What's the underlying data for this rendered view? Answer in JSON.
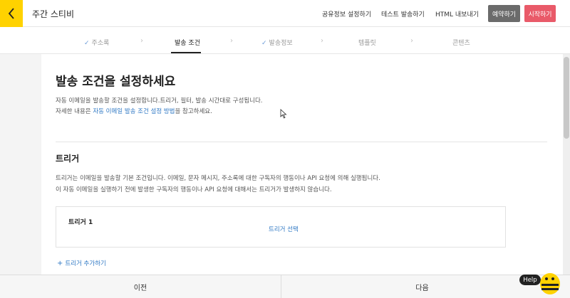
{
  "header": {
    "title": "주간 스티비",
    "links": [
      "공유정보 설정하기",
      "테스트 발송하기",
      "HTML 내보내기"
    ],
    "reserve_label": "예약하기",
    "start_label": "시작하기"
  },
  "steps": [
    {
      "label": "주소록",
      "checked": true
    },
    {
      "label": "발송 조건",
      "active": true
    },
    {
      "label": "발송정보",
      "checked": true
    },
    {
      "label": "템플릿"
    },
    {
      "label": "콘텐츠"
    }
  ],
  "main": {
    "title": "발송 조건을 설정하세요",
    "desc_line1": "자동 이메일을 발송할 조건을 설정합니다.트리거, 필터, 발송 시간대로 구성됩니다.",
    "desc_line2_prefix": "자세한 내용은 ",
    "desc_line2_link": "자동 이메일 발송 조건 설정 방법",
    "desc_line2_suffix": "을 참고하세요.",
    "section_title": "트리거",
    "section_desc1": "트리거는 이메일을 발송할 기본 조건입니다. 이메일, 문자 메시지, 주소록에 대한 구독자의 행동이나 API 요청에 의해 실행됩니다.",
    "section_desc2": "이 자동 이메일을 실행하기 전에 발생한 구독자의 행동이나 API 요청에 대해서는 트리거가 발생하지 않습니다.",
    "trigger_label": "트리거 1",
    "trigger_select": "트리거 선택",
    "add_trigger": "트리거 추가하기"
  },
  "footer": {
    "prev_label": "이전",
    "next_label": "다음"
  },
  "help": {
    "label": "Help"
  },
  "colors": {
    "accent_yellow": "#ffd200",
    "start_red": "#e95a69",
    "reserve_gray": "#6b6b6b",
    "link_blue": "#2f78c4"
  }
}
